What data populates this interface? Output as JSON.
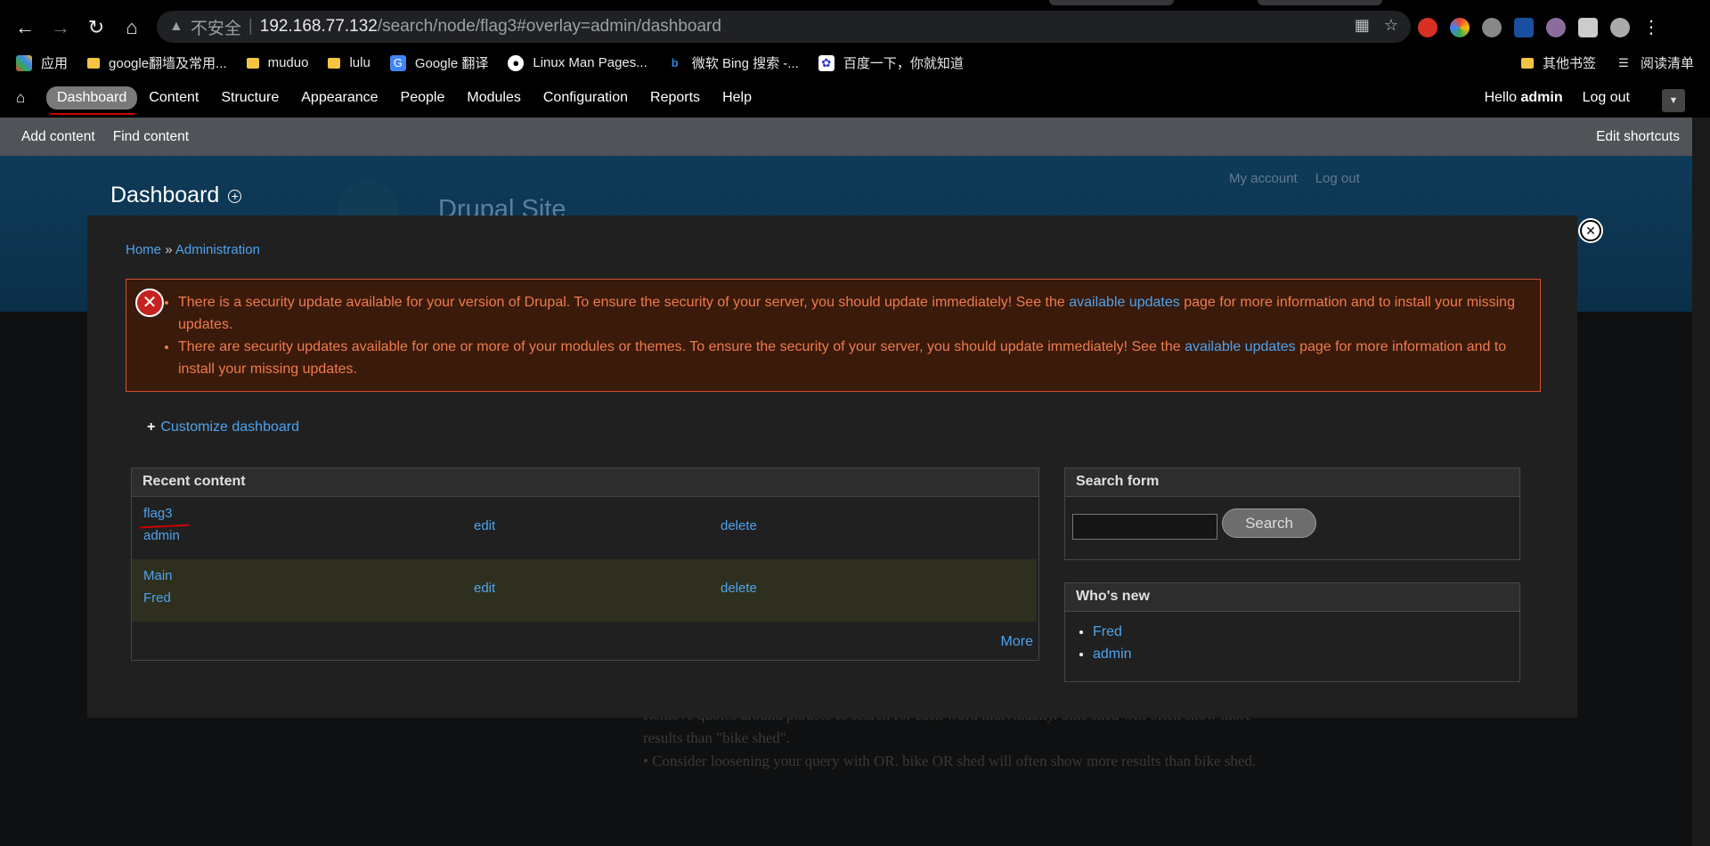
{
  "browser": {
    "insecure_label": "不安全",
    "url_host": "192.168.77.132",
    "url_path": "/search/node/flag3#overlay=admin/dashboard",
    "bookmarks": [
      "应用",
      "google翻墙及常用...",
      "muduo",
      "lulu",
      "Google 翻译",
      "Linux Man Pages...",
      "微软 Bing 搜索 -...",
      "百度一下，你就知道"
    ],
    "bookmarks_right": [
      "其他书签",
      "阅读清单"
    ]
  },
  "toolbar": {
    "items": [
      "Dashboard",
      "Content",
      "Structure",
      "Appearance",
      "People",
      "Modules",
      "Configuration",
      "Reports",
      "Help"
    ],
    "hello": "Hello",
    "user": "admin",
    "logout": "Log out"
  },
  "shortcuts": {
    "add_content": "Add content",
    "find_content": "Find content",
    "edit_shortcuts": "Edit shortcuts"
  },
  "background_page": {
    "title": "Dashboard",
    "site_name": "Drupal Site",
    "my_account": "My account",
    "log_out": "Log out",
    "text_line1": "Remove quotes around phrases to search for each word individually. bike shed will often show more",
    "text_line2": "results than \"bike shed\".",
    "text_line3": "Consider loosening your query with OR. bike OR shed will often show more results than bike shed."
  },
  "overlay": {
    "breadcrumb": {
      "home": "Home",
      "sep": "»",
      "admin": "Administration"
    },
    "messages": {
      "m1_a": "There is a security update available for your version of Drupal. To ensure the security of your server, you should update immediately! See the ",
      "m1_link": "available updates",
      "m1_b": " page for more information and to install your missing updates.",
      "m2_a": "There are security updates available for one or more of your modules or themes. To ensure the security of your server, you should update immediately! See the ",
      "m2_link": "available updates",
      "m2_b": " page for more information and to install your missing updates."
    },
    "customize": "Customize dashboard",
    "recent": {
      "title": "Recent content",
      "rows": [
        {
          "title": "flag3",
          "author": "admin",
          "edit": "edit",
          "delete": "delete"
        },
        {
          "title": "Main",
          "author": "Fred",
          "edit": "edit",
          "delete": "delete"
        }
      ],
      "more": "More"
    },
    "search": {
      "title": "Search form",
      "button": "Search"
    },
    "whos_new": {
      "title": "Who's new",
      "users": [
        "Fred",
        "admin"
      ]
    }
  }
}
